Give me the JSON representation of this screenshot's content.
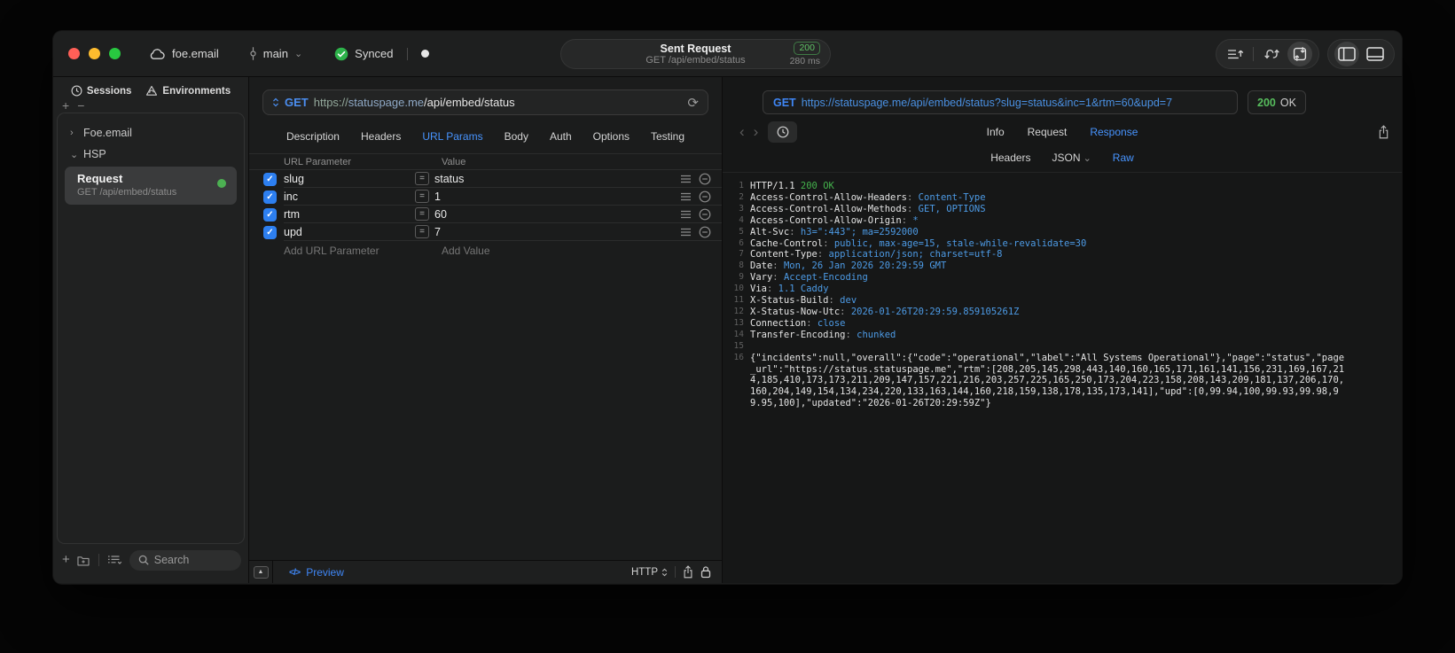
{
  "titlebar": {
    "project": "foe.email",
    "branch": "main",
    "sync_status": "Synced",
    "center": {
      "title": "Sent Request",
      "subtitle": "GET /api/embed/status",
      "status_code": "200",
      "duration": "280 ms"
    }
  },
  "sidebar": {
    "tabs": {
      "sessions": "Sessions",
      "environments": "Environments"
    },
    "tree": {
      "group1": "Foe.email",
      "group2": "HSP"
    },
    "selected_request": {
      "name": "Request",
      "method_path": "GET /api/embed/status"
    },
    "search_placeholder": "Search"
  },
  "request_editor": {
    "method": "GET",
    "url_scheme": "https://",
    "url_host": "statuspage.me",
    "url_path": "/api/embed/status",
    "tabs": [
      "Description",
      "Headers",
      "URL Params",
      "Body",
      "Auth",
      "Options",
      "Testing"
    ],
    "active_tab": "URL Params",
    "params_table": {
      "columns": [
        "URL Parameter",
        "Value"
      ],
      "rows": [
        {
          "name": "slug",
          "value": "status",
          "enabled": true
        },
        {
          "name": "inc",
          "value": "1",
          "enabled": true
        },
        {
          "name": "rtm",
          "value": "60",
          "enabled": true
        },
        {
          "name": "upd",
          "value": "7",
          "enabled": true
        }
      ],
      "add_row": {
        "name_placeholder": "Add URL Parameter",
        "value_placeholder": "Add Value"
      }
    },
    "footer": {
      "preview_label": "Preview",
      "code_glyph": "</>",
      "protocol": "HTTP"
    }
  },
  "response_viewer": {
    "request_line": {
      "method": "GET",
      "url": "https://statuspage.me/api/embed/status?slug=status&inc=1&rtm=60&upd=7"
    },
    "status": {
      "code": "200",
      "text": "OK"
    },
    "tabs": [
      "Info",
      "Request",
      "Response"
    ],
    "active_tab": "Response",
    "subtabs": [
      "Headers",
      "JSON",
      "Raw"
    ],
    "active_subtab": "Raw",
    "lines": [
      {
        "n": "1",
        "parts": [
          [
            "HTTP/1.1 ",
            "plain"
          ],
          [
            "200 OK",
            "green"
          ]
        ]
      },
      {
        "n": "2",
        "parts": [
          [
            "Access-Control-Allow-Headers",
            "plain"
          ],
          [
            ": ",
            "dim"
          ],
          [
            "Content-Type",
            "blue"
          ]
        ]
      },
      {
        "n": "3",
        "parts": [
          [
            "Access-Control-Allow-Methods",
            "plain"
          ],
          [
            ": ",
            "dim"
          ],
          [
            "GET, OPTIONS",
            "blue"
          ]
        ]
      },
      {
        "n": "4",
        "parts": [
          [
            "Access-Control-Allow-Origin",
            "plain"
          ],
          [
            ": ",
            "dim"
          ],
          [
            "*",
            "blue"
          ]
        ]
      },
      {
        "n": "5",
        "parts": [
          [
            "Alt-Svc",
            "plain"
          ],
          [
            ": ",
            "dim"
          ],
          [
            "h3=\":443\"; ma=2592000",
            "blue"
          ]
        ]
      },
      {
        "n": "6",
        "parts": [
          [
            "Cache-Control",
            "plain"
          ],
          [
            ": ",
            "dim"
          ],
          [
            "public, max-age=15, stale-while-revalidate=30",
            "blue"
          ]
        ]
      },
      {
        "n": "7",
        "parts": [
          [
            "Content-Type",
            "plain"
          ],
          [
            ": ",
            "dim"
          ],
          [
            "application/json; charset=utf-8",
            "blue"
          ]
        ]
      },
      {
        "n": "8",
        "parts": [
          [
            "Date",
            "plain"
          ],
          [
            ": ",
            "dim"
          ],
          [
            "Mon, 26 Jan 2026 20:29:59 GMT",
            "blue"
          ]
        ]
      },
      {
        "n": "9",
        "parts": [
          [
            "Vary",
            "plain"
          ],
          [
            ": ",
            "dim"
          ],
          [
            "Accept-Encoding",
            "blue"
          ]
        ]
      },
      {
        "n": "10",
        "parts": [
          [
            "Via",
            "plain"
          ],
          [
            ": ",
            "dim"
          ],
          [
            "1.1 Caddy",
            "blue"
          ]
        ]
      },
      {
        "n": "11",
        "parts": [
          [
            "X-Status-Build",
            "plain"
          ],
          [
            ": ",
            "dim"
          ],
          [
            "dev",
            "blue"
          ]
        ]
      },
      {
        "n": "12",
        "parts": [
          [
            "X-Status-Now-Utc",
            "plain"
          ],
          [
            ": ",
            "dim"
          ],
          [
            "2026-01-26T20:29:59.859105261Z",
            "blue"
          ]
        ]
      },
      {
        "n": "13",
        "parts": [
          [
            "Connection",
            "plain"
          ],
          [
            ": ",
            "dim"
          ],
          [
            "close",
            "blue"
          ]
        ]
      },
      {
        "n": "14",
        "parts": [
          [
            "Transfer-Encoding",
            "plain"
          ],
          [
            ": ",
            "dim"
          ],
          [
            "chunked",
            "blue"
          ]
        ]
      },
      {
        "n": "15",
        "parts": []
      },
      {
        "n": "16",
        "parts": [
          [
            "{\"incidents\":null,\"overall\":{\"code\":\"operational\",\"label\":\"All Systems Operational\"},\"page\":\"status\",\"page_url\":\"https://status.statuspage.me\",\"rtm\":[208,205,145,298,443,140,160,165,171,161,141,156,231,169,167,214,185,410,173,173,211,209,147,157,221,216,203,257,225,165,250,173,204,223,158,208,143,209,181,137,206,170,160,204,149,154,134,234,220,133,163,144,160,218,159,138,178,135,173,141],\"upd\":[0,99.94,100,99.93,99.98,99.95,100],\"updated\":\"2026-01-26T20:29:59Z\"}",
            "plain"
          ]
        ]
      }
    ]
  },
  "colors": {
    "accent_blue": "#4794ff",
    "status_green": "#44b24c",
    "checkbox_blue": "#2d7ff0"
  }
}
